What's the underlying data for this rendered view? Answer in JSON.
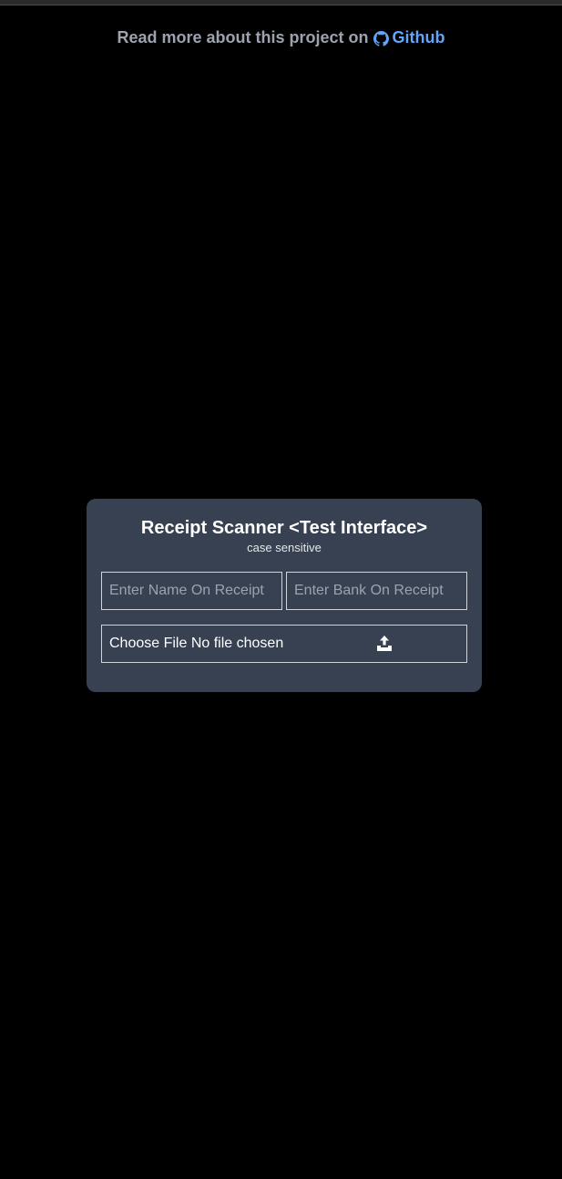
{
  "header": {
    "prefix": "Read more about this project on",
    "link_label": "Github",
    "link_icon": "github-icon",
    "colors": {
      "prefix": "#9ca3af",
      "link": "#60a5fa"
    }
  },
  "card": {
    "title": "Receipt Scanner <Test Interface>",
    "subtitle": "case sensitive",
    "name_input": {
      "placeholder": "Enter Name On Receipt",
      "value": ""
    },
    "bank_input": {
      "placeholder": "Enter Bank On Receipt",
      "value": ""
    },
    "file_input": {
      "button_label": "Choose File",
      "status": "No file chosen",
      "icon": "upload-icon"
    },
    "colors": {
      "background": "#374151",
      "border": "#d1d5db"
    }
  },
  "page": {
    "background": "#000000"
  }
}
